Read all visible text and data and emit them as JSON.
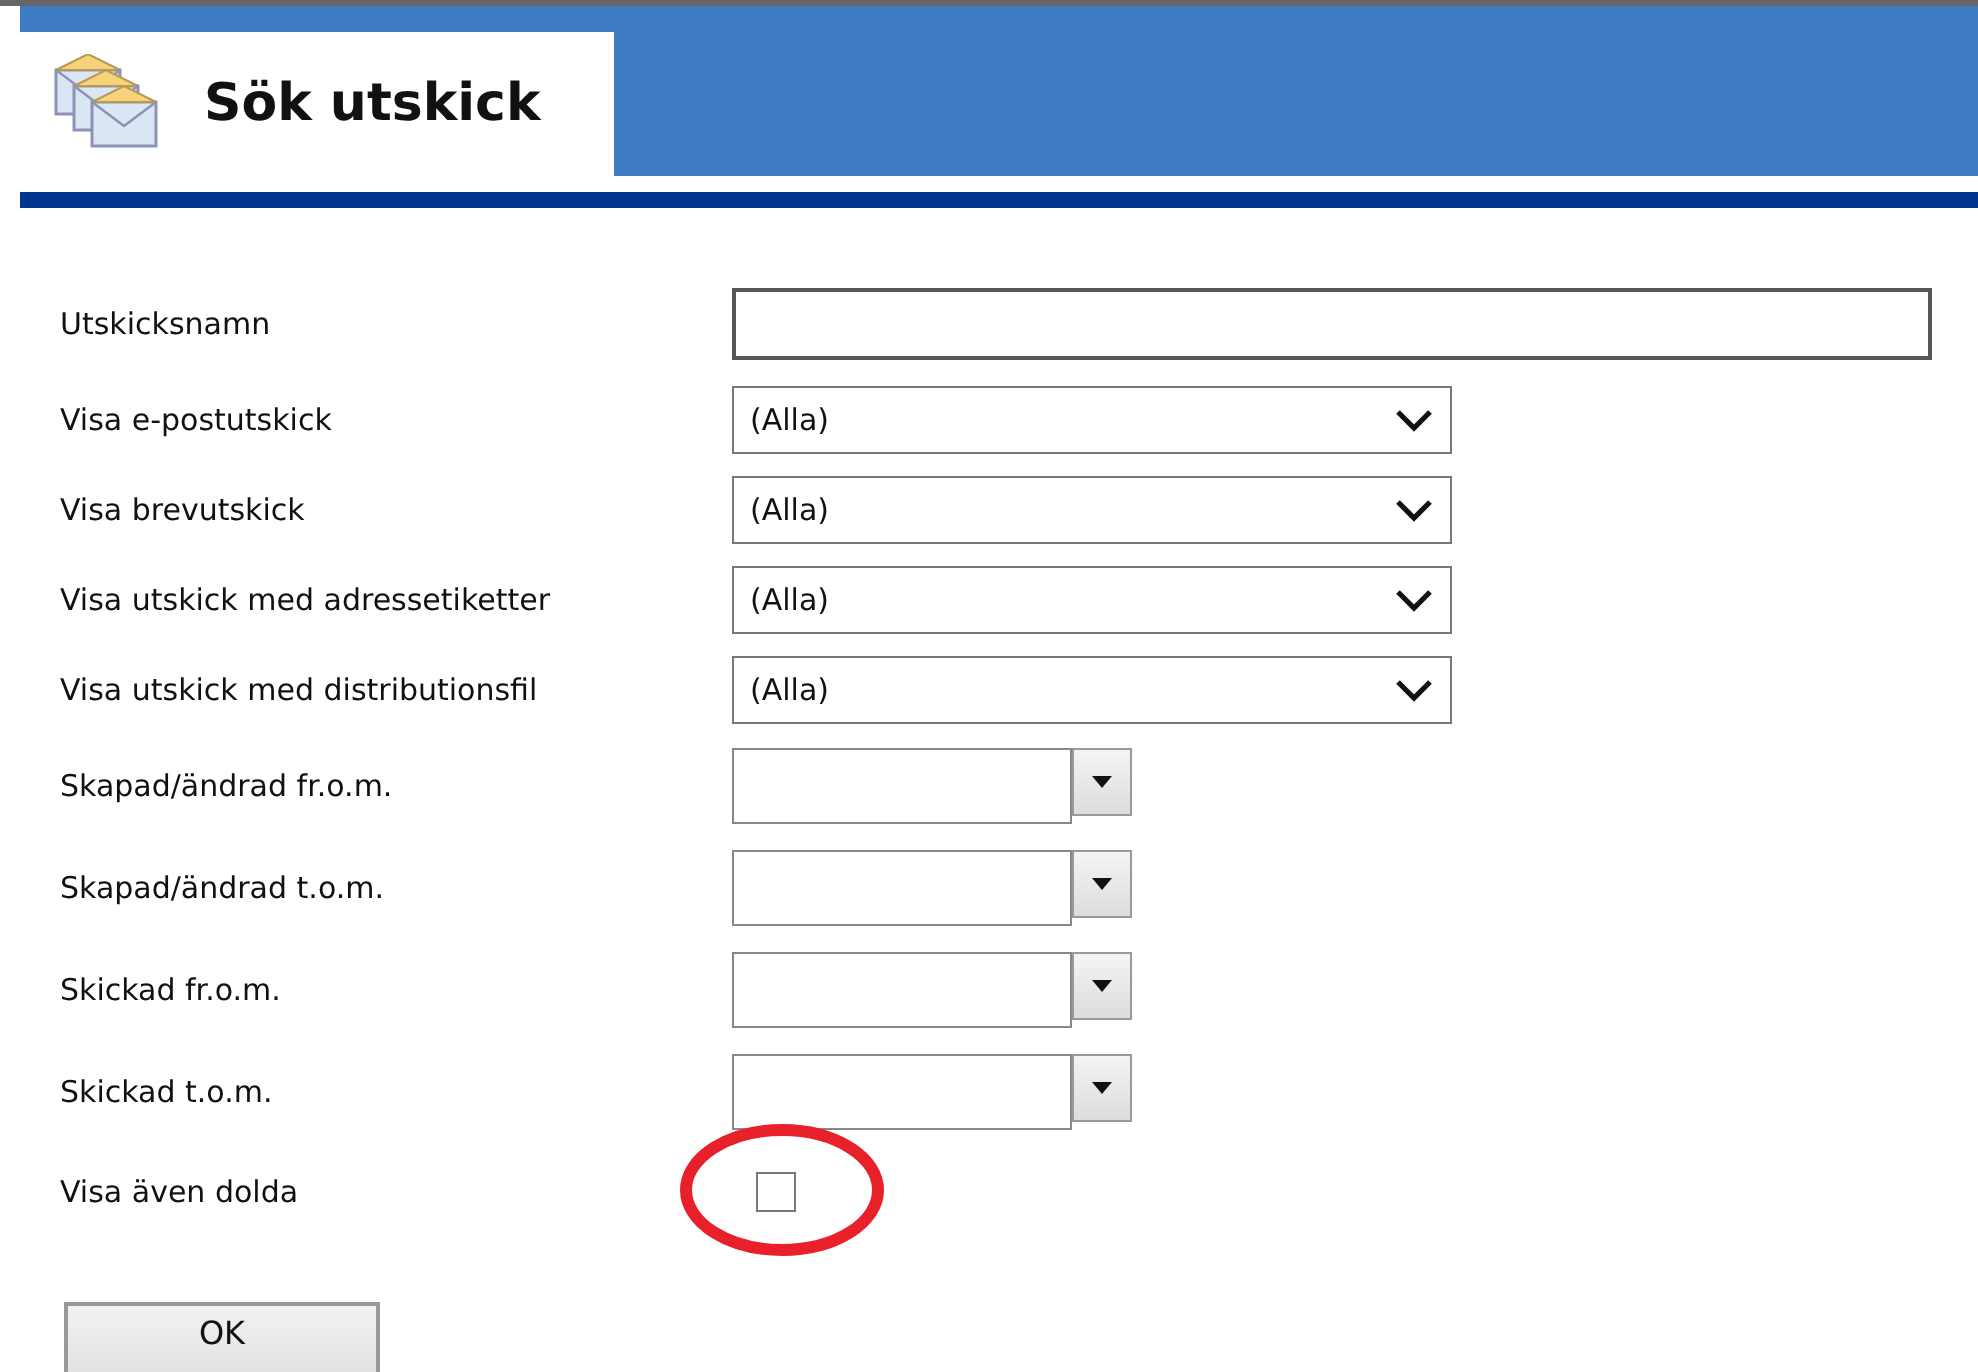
{
  "header": {
    "title": "Sök utskick"
  },
  "fields": [
    {
      "kind": "text",
      "label": "Utskicksnamn"
    },
    {
      "kind": "select",
      "label": "Visa e-postutskick",
      "value": "(Alla)"
    },
    {
      "kind": "select",
      "label": "Visa brevutskick",
      "value": "(Alla)"
    },
    {
      "kind": "select",
      "label": "Visa utskick med adressetiketter",
      "value": "(Alla)"
    },
    {
      "kind": "select",
      "label": "Visa utskick med distributionsfil",
      "value": "(Alla)"
    },
    {
      "kind": "date",
      "label": "Skapad/ändrad fr.o.m."
    },
    {
      "kind": "date",
      "label": "Skapad/ändrad t.o.m."
    },
    {
      "kind": "date",
      "label": "Skickad fr.o.m."
    },
    {
      "kind": "date",
      "label": "Skickad t.o.m."
    },
    {
      "kind": "checkbox",
      "label": "Visa även dolda",
      "checked": false,
      "annotated": true
    }
  ],
  "buttons": [
    "OK"
  ]
}
